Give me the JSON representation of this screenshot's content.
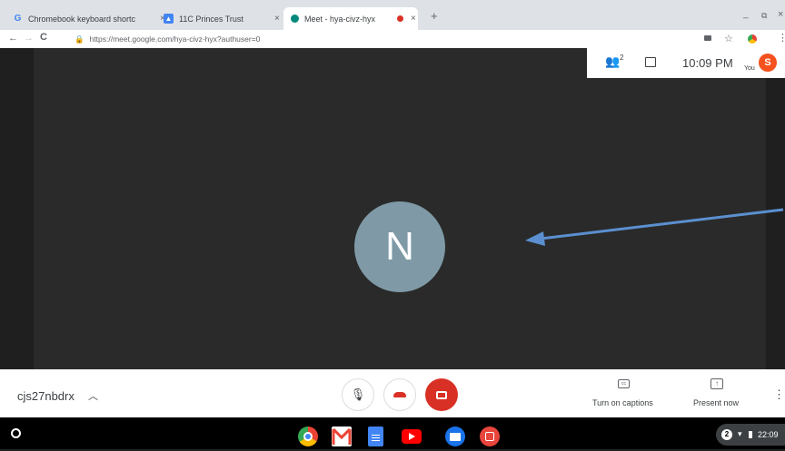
{
  "tabs": [
    {
      "title": "Chromebook keyboard shortcuts",
      "icon": "google-icon"
    },
    {
      "title": "11C Princes Trust",
      "icon": "classroom-icon"
    },
    {
      "title": "Meet - hya-civz-hyx",
      "icon": "meet-icon",
      "recording": true
    }
  ],
  "new_tab_label": "+",
  "window_controls": {
    "minimize": "_",
    "restore": "⧉",
    "close": "×"
  },
  "address_bar": {
    "url": "https://meet.google.com/hya-civz-hyx?authuser=0"
  },
  "meet": {
    "participant_count": "2",
    "time": "10:09 PM",
    "self_label": "You",
    "self_initial": "S",
    "participant_initial": "N",
    "meeting_code": "cjs27nbdrx",
    "captions_label": "Turn on captions",
    "present_label": "Present now"
  },
  "shelf": {
    "clock": "22:09",
    "notification_count": "2"
  },
  "colors": {
    "arrow": "#5b8fd0",
    "end_call": "#d93025",
    "avatar": "#7f9aa6",
    "self_avatar": "#f4511e"
  }
}
